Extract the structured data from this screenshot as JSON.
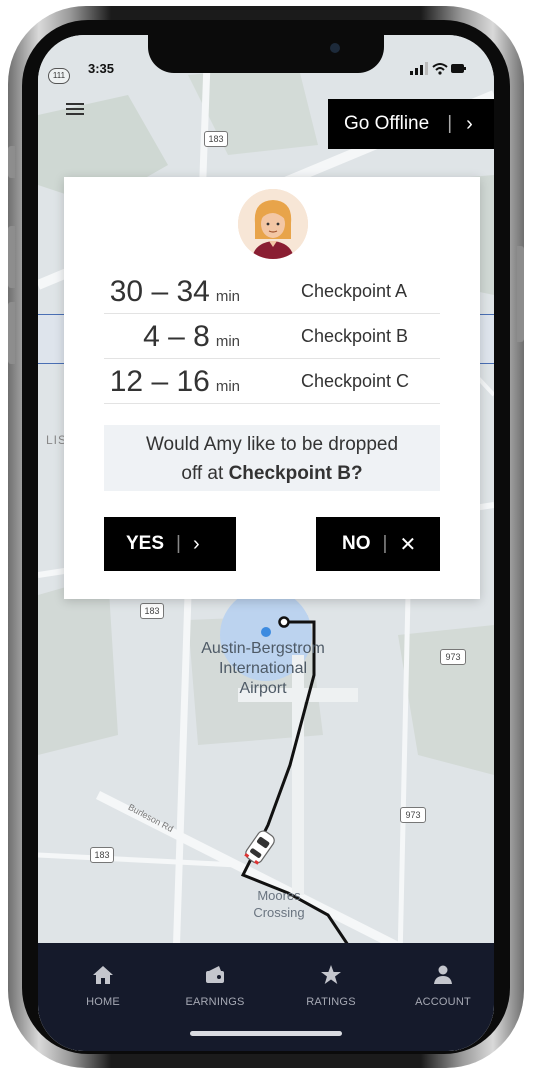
{
  "status": {
    "time": "3:35",
    "badge": "111"
  },
  "top_button": {
    "label": "Go Offline"
  },
  "etas": [
    {
      "range": "30 – 34",
      "unit": "min",
      "checkpoint": "Checkpoint A"
    },
    {
      "range": "4 – 8",
      "unit": "min",
      "checkpoint": "Checkpoint B"
    },
    {
      "range": "12 – 16",
      "unit": "min",
      "checkpoint": "Checkpoint C"
    }
  ],
  "question": {
    "line1": "Would Amy like to be dropped",
    "line2_prefix": "off at ",
    "line2_bold": "Checkpoint B?"
  },
  "buttons": {
    "yes": "YES",
    "no": "NO"
  },
  "map_labels": {
    "airport_l1": "Austin-Bergstrom",
    "airport_l2": "International",
    "airport_l3": "Airport",
    "moores_l1": "Moores",
    "moores_l2": "Crossing",
    "road_183": "183",
    "road_973": "973",
    "road_rd": "Burleson Rd",
    "edge_lis": "LIS"
  },
  "tabs": [
    {
      "label": "HOME",
      "icon": "home-icon"
    },
    {
      "label": "EARNINGS",
      "icon": "wallet-icon"
    },
    {
      "label": "RATINGS",
      "icon": "star-icon"
    },
    {
      "label": "ACCOUNT",
      "icon": "account-icon"
    }
  ],
  "colors": {
    "accent": "#000000",
    "tabbar": "#151a2b",
    "highlight": "#e9f0fb",
    "route": "#111111",
    "pin": "#3d8be0"
  }
}
